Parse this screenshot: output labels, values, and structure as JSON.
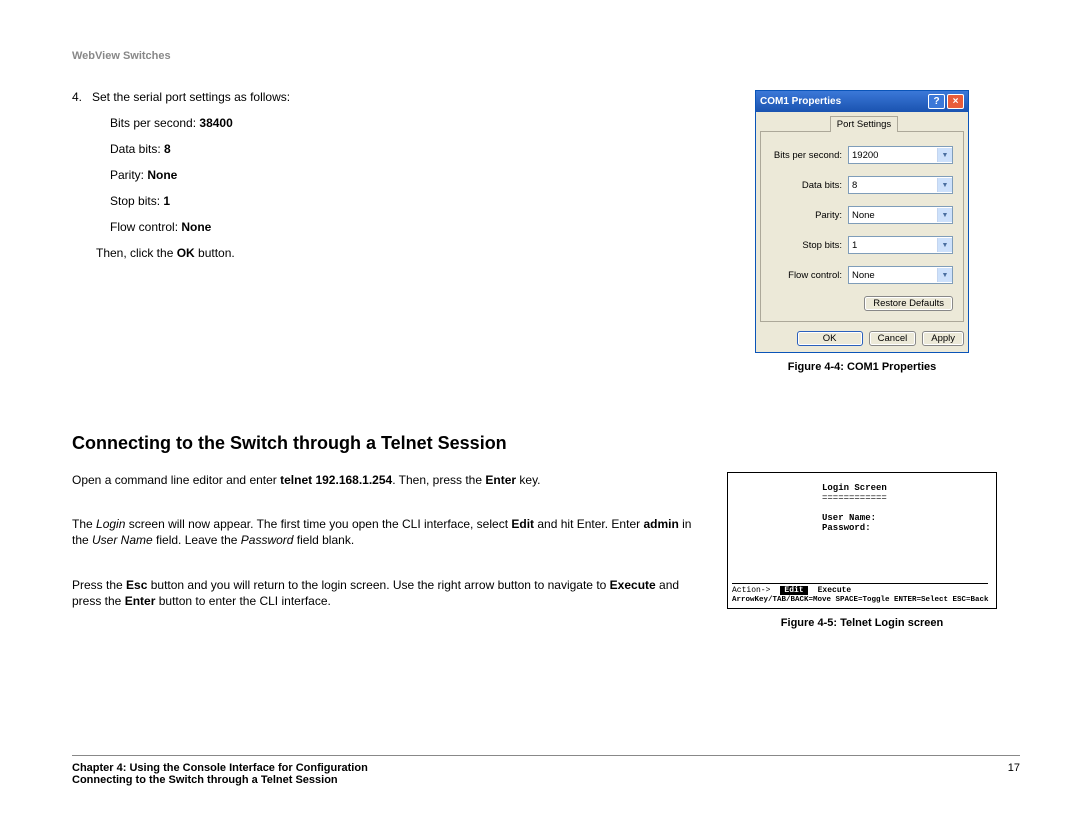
{
  "header": "WebView Switches",
  "step": {
    "num": "4.",
    "text": "Set the serial port settings as follows:",
    "bps_label": "Bits per second: ",
    "bps_value": "38400",
    "databits_label": "Data bits: ",
    "databits_value": "8",
    "parity_label": "Parity: ",
    "parity_value": "None",
    "stopbits_label": "Stop bits: ",
    "stopbits_value": "1",
    "flow_label": "Flow control: ",
    "flow_value": "None",
    "then_pre": "Then, click the ",
    "then_bold": "OK",
    "then_post": " button."
  },
  "section_heading": "Connecting to the Switch through a Telnet Session",
  "para1": {
    "a": "Open a command line editor and enter ",
    "b": "telnet 192.168.1.254",
    "c": ". Then, press the ",
    "d": "Enter",
    "e": " key."
  },
  "para2": {
    "a": "The ",
    "b": "Login",
    "c": " screen will now appear. The first time you open the CLI interface, select ",
    "d": "Edit",
    "e": " and hit Enter. Enter ",
    "f": "admin",
    "g": " in the ",
    "h": "User Name",
    "i": " field. Leave the ",
    "j": "Password",
    "k": " field blank."
  },
  "para3": {
    "a": "Press the ",
    "b": "Esc",
    "c": " button and you will return to the login screen. Use the right arrow button to navigate to ",
    "d": "Execute",
    "e": " and press the ",
    "f": "Enter",
    "g": " button to enter the CLI interface."
  },
  "dialog": {
    "title": "COM1 Properties",
    "tab": "Port Settings",
    "rows": {
      "bps_label": "Bits per second:",
      "bps_value": "19200",
      "databits_label": "Data bits:",
      "databits_value": "8",
      "parity_label": "Parity:",
      "parity_value": "None",
      "stopbits_label": "Stop bits:",
      "stopbits_value": "1",
      "flow_label": "Flow control:",
      "flow_value": "None"
    },
    "restore": "Restore Defaults",
    "ok": "OK",
    "cancel": "Cancel",
    "apply": "Apply",
    "caption": "Figure 4-4: COM1 Properties"
  },
  "terminal": {
    "title": "Login Screen",
    "underline": "============",
    "user": "User Name:",
    "pass": "Password:",
    "action": "Action->",
    "edit": "Edit",
    "execute": "Execute",
    "hints": "ArrowKey/TAB/BACK=Move  SPACE=Toggle  ENTER=Select  ESC=Back",
    "caption": "Figure 4-5: Telnet Login screen"
  },
  "footer": {
    "chapter": "Chapter 4: Using the Console Interface for Configuration",
    "section": "Connecting to the Switch through a Telnet Session",
    "page": "17"
  }
}
